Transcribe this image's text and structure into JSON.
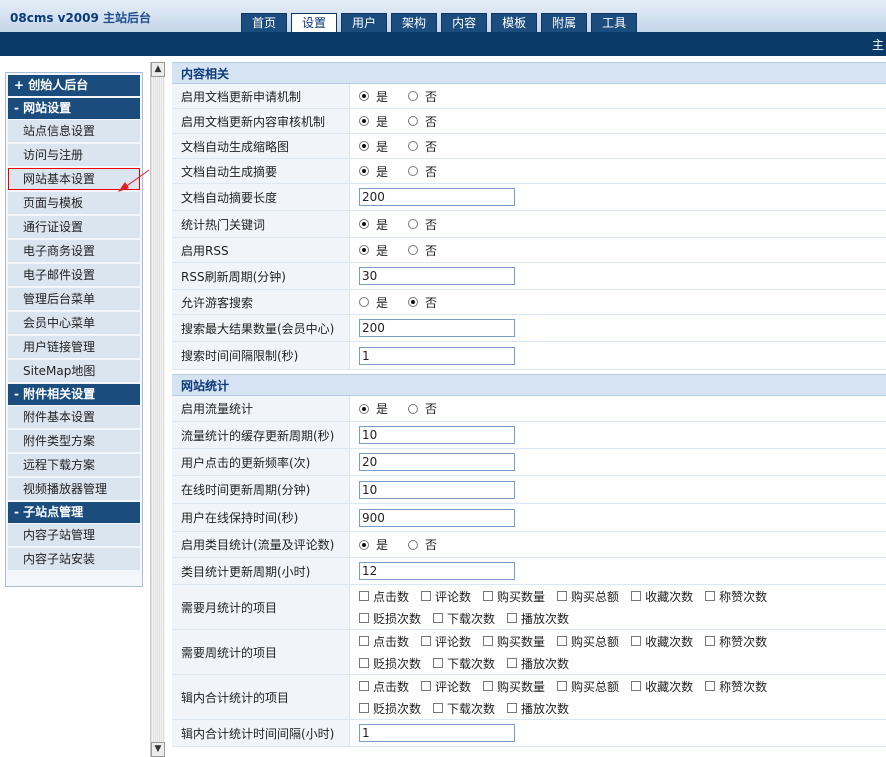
{
  "header": {
    "logo_main": "08cms v2009",
    "logo_suffix": "主站后台",
    "tabs": [
      {
        "label": "首页",
        "active": false
      },
      {
        "label": "设置",
        "active": true
      },
      {
        "label": "用户",
        "active": false
      },
      {
        "label": "架构",
        "active": false
      },
      {
        "label": "内容",
        "active": false
      },
      {
        "label": "模板",
        "active": false
      },
      {
        "label": "附属",
        "active": false
      },
      {
        "label": "工具",
        "active": false
      }
    ],
    "bar_text": "主"
  },
  "sidebar": {
    "founder": "+ 创始人后台",
    "site_settings": {
      "title": "- 网站设置",
      "items": [
        "站点信息设置",
        "访问与注册",
        "网站基本设置",
        "页面与模板",
        "通行证设置",
        "电子商务设置",
        "电子邮件设置",
        "管理后台菜单",
        "会员中心菜单",
        "用户链接管理",
        "SiteMap地图"
      ]
    },
    "attach": {
      "title": "- 附件相关设置",
      "items": [
        "附件基本设置",
        "附件类型方案",
        "远程下载方案",
        "视频播放器管理"
      ]
    },
    "subsite": {
      "title": "- 子站点管理",
      "items": [
        "内容子站管理",
        "内容子站安装"
      ]
    }
  },
  "options": {
    "yes": "是",
    "no": "否"
  },
  "content": {
    "section1": {
      "title": "内容相关",
      "rows": {
        "r1": {
          "label": "启用文档更新申请机制",
          "value": "yes"
        },
        "r2": {
          "label": "启用文档更新内容审核机制",
          "value": "yes"
        },
        "r3": {
          "label": "文档自动生成缩略图",
          "value": "yes"
        },
        "r4": {
          "label": "文档自动生成摘要",
          "value": "yes"
        },
        "r5": {
          "label": "文档自动摘要长度",
          "value": "200"
        },
        "r6": {
          "label": "统计热门关键词",
          "value": "yes"
        },
        "r7": {
          "label": "启用RSS",
          "value": "yes"
        },
        "r8": {
          "label": "RSS刷新周期(分钟)",
          "value": "30"
        },
        "r9": {
          "label": "允许游客搜索",
          "value": "no"
        },
        "r10": {
          "label": "搜索最大结果数量(会员中心)",
          "value": "200"
        },
        "r11": {
          "label": "搜索时间间隔限制(秒)",
          "value": "1"
        }
      }
    },
    "section2": {
      "title": "网站统计",
      "rows": {
        "r1": {
          "label": "启用流量统计",
          "value": "yes"
        },
        "r2": {
          "label": "流量统计的缓存更新周期(秒)",
          "value": "10"
        },
        "r3": {
          "label": "用户点击的更新频率(次)",
          "value": "20"
        },
        "r4": {
          "label": "在线时间更新周期(分钟)",
          "value": "10"
        },
        "r5": {
          "label": "用户在线保持时间(秒)",
          "value": "900"
        },
        "r6": {
          "label": "启用类目统计(流量及评论数)",
          "value": "yes"
        },
        "r7": {
          "label": "类目统计更新周期(小时)",
          "value": "12"
        },
        "r8": {
          "label": "需要月统计的项目"
        },
        "r9": {
          "label": "需要周统计的项目"
        },
        "r10": {
          "label": "辑内合计统计的项目"
        },
        "r11": {
          "label": "辑内合计统计时间间隔(小时)",
          "value": "1"
        }
      },
      "stat_items": [
        "点击数",
        "评论数",
        "购买数量",
        "购买总额",
        "收藏次数",
        "称赞次数",
        "贬损次数",
        "下载次数",
        "播放次数"
      ]
    }
  }
}
